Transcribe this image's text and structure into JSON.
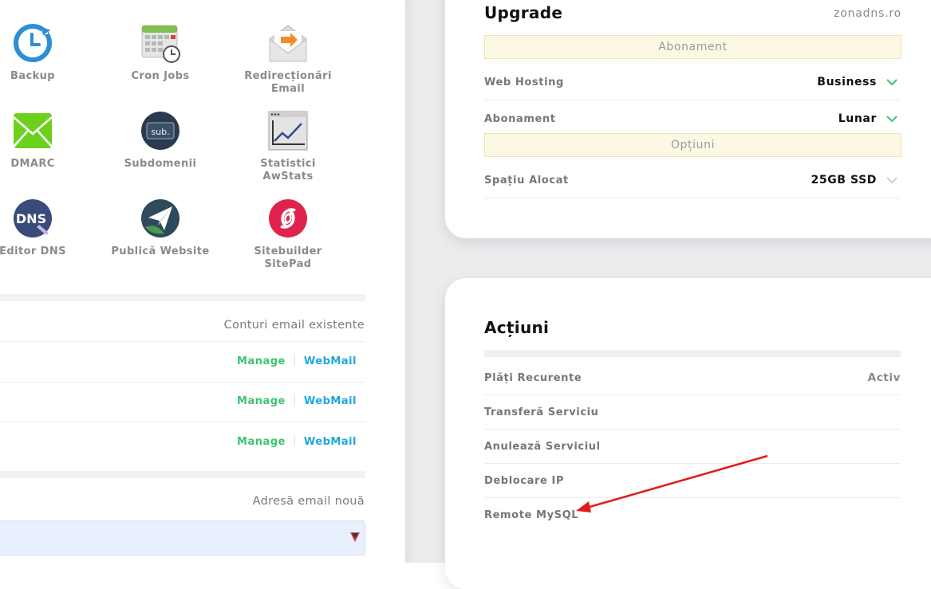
{
  "tools": [
    {
      "label": "Backup",
      "icon": "backup-icon"
    },
    {
      "label": "Cron Jobs",
      "icon": "calendar-clock-icon"
    },
    {
      "label": "Redirecționări Email",
      "icon": "email-forward-icon"
    },
    {
      "label": "DMARC",
      "icon": "envelope-icon"
    },
    {
      "label": "Subdomenii",
      "icon": "subdomain-icon"
    },
    {
      "label": "Statistici AwStats",
      "icon": "stats-chart-icon"
    },
    {
      "label": "Editor DNS",
      "icon": "dns-icon"
    },
    {
      "label": "Publică Website",
      "icon": "paper-plane-icon"
    },
    {
      "label": "Sitebuilder SitePad",
      "icon": "sitepad-icon"
    }
  ],
  "accounts": {
    "header": "Conturi email existente",
    "rows": [
      {
        "manage": "Manage",
        "webmail": "WebMail"
      },
      {
        "manage": "Manage",
        "webmail": "WebMail"
      },
      {
        "manage": "Manage",
        "webmail": "WebMail"
      }
    ]
  },
  "new_email": {
    "header": "Adresă email nouă",
    "value": ""
  },
  "upgrade": {
    "title": "Upgrade",
    "domain": "zonadns.ro",
    "banner_subscription": "Abonament",
    "banner_options": "Opțiuni",
    "rows": [
      {
        "key": "Web Hosting",
        "value": "Business"
      },
      {
        "key": "Abonament",
        "value": "Lunar"
      },
      {
        "key": "Spațiu Alocat",
        "value": "25GB SSD"
      }
    ]
  },
  "actions": {
    "title": "Acțiuni",
    "rows": [
      {
        "key": "Plăți Recurente",
        "value": "Activ"
      },
      {
        "key": "Transferă Serviciu",
        "value": ""
      },
      {
        "key": "Anulează Serviciul",
        "value": ""
      },
      {
        "key": "Deblocare IP",
        "value": ""
      },
      {
        "key": "Remote MySQL",
        "value": ""
      }
    ]
  },
  "colors": {
    "manage": "#3ec272",
    "webmail": "#1fa7dc",
    "chevron_active": "#3ec272",
    "annotation_arrow": "#e01b1b"
  }
}
